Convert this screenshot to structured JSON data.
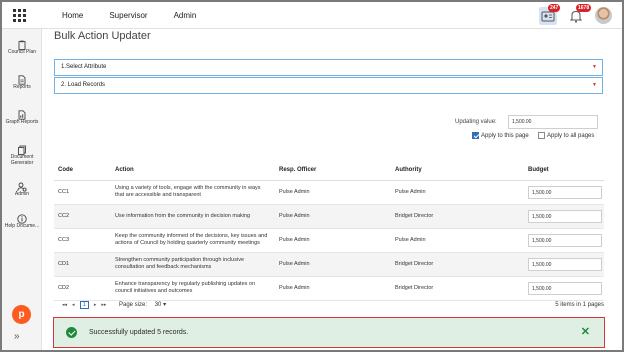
{
  "nav": {
    "items": [
      "Home",
      "Supervisor",
      "Admin"
    ]
  },
  "topbar": {
    "badges": {
      "messages": "247",
      "notifications": "1678"
    },
    "icons": [
      "apps-grid-icon",
      "id-card-icon",
      "bell-icon",
      "avatar"
    ]
  },
  "sidebar": {
    "items": [
      {
        "label": "Council Plan",
        "icon": "clipboard-icon"
      },
      {
        "label": "Reports",
        "icon": "document-icon"
      },
      {
        "label": "Graph Reports",
        "icon": "graph-document-icon"
      },
      {
        "label": "Document Generator",
        "icon": "document-stack-icon"
      },
      {
        "label": "Admin",
        "icon": "admin-gear-icon"
      },
      {
        "label": "Help Docume...",
        "icon": "info-icon"
      }
    ],
    "collapse": "»"
  },
  "page": {
    "title": "Bulk Action Updater"
  },
  "accordion": [
    {
      "label": "1.Select Attribute"
    },
    {
      "label": "2. Load Records"
    }
  ],
  "update": {
    "label": "Updating value:",
    "value": "1,500.00",
    "apply_page": "Apply to this page",
    "apply_all": "Apply to all pages"
  },
  "table": {
    "headers": [
      "Code",
      "Action",
      "Resp. Officer",
      "Authority",
      "Budget"
    ],
    "rows": [
      {
        "code": "CC1",
        "action": "Using a variety of tools, engage with the community in ways that are accessible and transparent",
        "officer": "Pulse Admin",
        "authority": "Pulse Admin",
        "budget": "1,500.00"
      },
      {
        "code": "CC2",
        "action": "Use information from the community in decision making",
        "officer": "Pulse Admin",
        "authority": "Bridget Director",
        "budget": "1,500.00"
      },
      {
        "code": "CC3",
        "action": "Keep the community informed of the decisions, key issues and actions of Council by holding quarterly community meetings",
        "officer": "Pulse Admin",
        "authority": "Pulse Admin",
        "budget": "1,500.00"
      },
      {
        "code": "CD1",
        "action": "Strengthen community participation through inclusive consultation and feedback mechanisms",
        "officer": "Pulse Admin",
        "authority": "Bridget Director",
        "budget": "1,500.00"
      },
      {
        "code": "CD2",
        "action": "Enhance transparency by regularly publishing updates on council initiatives and outcomes",
        "officer": "Pulse Admin",
        "authority": "Bridget Director",
        "budget": "1,500.00"
      }
    ]
  },
  "pager": {
    "first": "◂◂",
    "prev": "◂",
    "page": "1",
    "next": "▸",
    "last": "▸▸",
    "page_size_label": "Page size:",
    "page_size": "30",
    "info": "5 items in 1 pages"
  },
  "toast": {
    "message": "Successfully updated 5 records.",
    "close": "✕"
  },
  "colors": {
    "accent": "#2f6fb6",
    "success": "#1f8a3c",
    "toast_bg": "#e0efe3",
    "error_outline": "#d9343b",
    "logo": "#ff5a1f"
  }
}
